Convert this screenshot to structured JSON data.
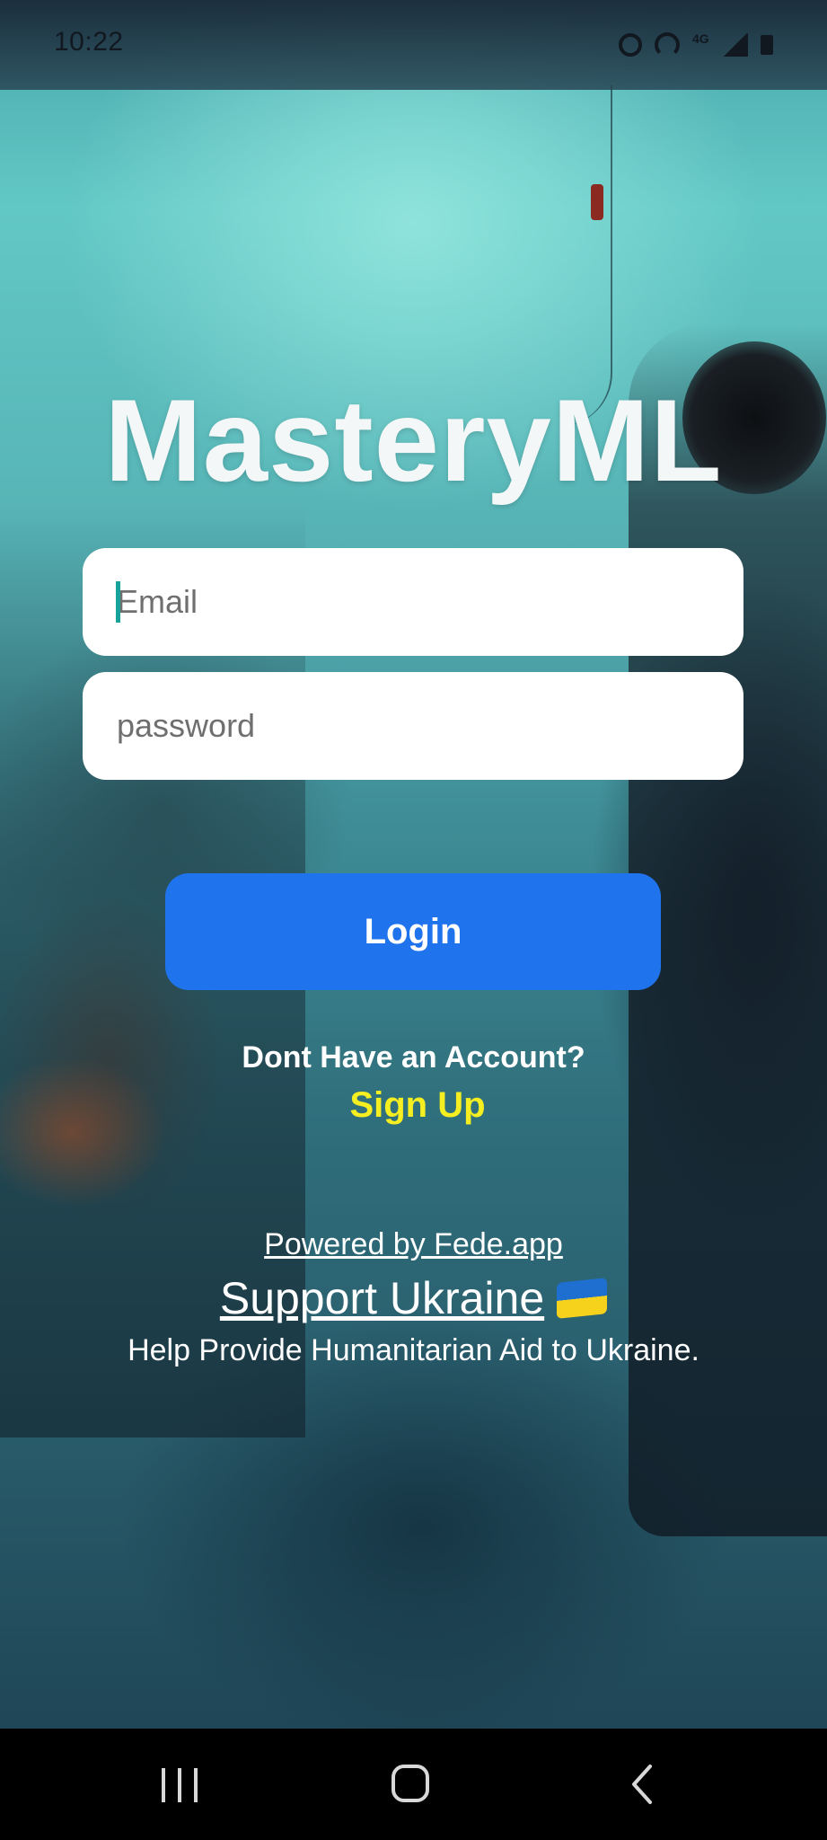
{
  "status_bar": {
    "time": "10:22",
    "icons": [
      "alarm-icon",
      "hotspot-icon",
      "4g-icon",
      "signal-icon",
      "battery-icon"
    ],
    "network_label": "4G"
  },
  "app": {
    "title": "MasteryML"
  },
  "login_form": {
    "email_placeholder": "Email",
    "password_placeholder": "password",
    "login_label": "Login"
  },
  "signup": {
    "prompt": "Dont Have an Account?",
    "link_label": "Sign Up"
  },
  "footer": {
    "powered_by": "Powered by Fede.app",
    "support_label": "Support Ukraine",
    "support_flag_icon": "ukraine-flag-icon",
    "help_text": "Help Provide Humanitarian Aid to Ukraine."
  },
  "nav_bar": {
    "buttons": [
      "recents-icon",
      "home-icon",
      "back-icon"
    ]
  },
  "colors": {
    "login_button": "#1f74ee",
    "signup_link": "#f5ee20",
    "title": "#f4f7f7",
    "field_background": "#ffffff"
  }
}
